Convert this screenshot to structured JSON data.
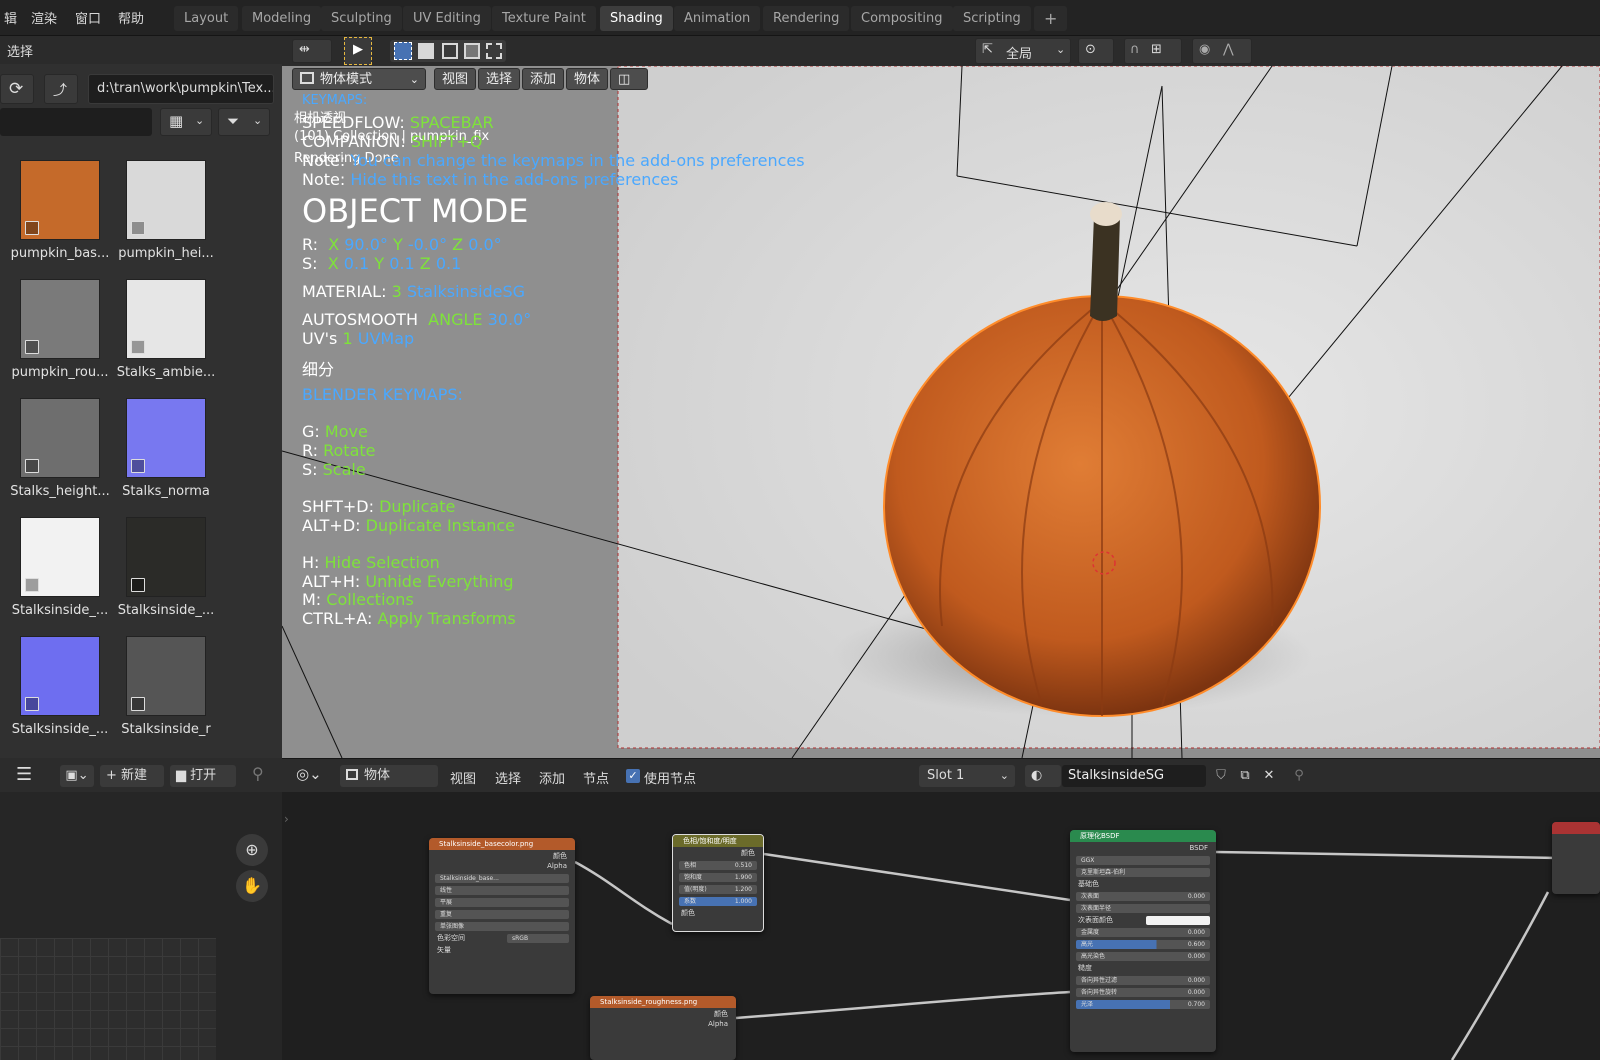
{
  "menu": [
    "辑",
    "渲染",
    "窗口",
    "帮助"
  ],
  "workspaces": [
    {
      "label": "Layout",
      "active": false
    },
    {
      "label": "Modeling",
      "active": false
    },
    {
      "label": "Sculpting",
      "active": false
    },
    {
      "label": "UV Editing",
      "active": false
    },
    {
      "label": "Texture Paint",
      "active": false
    },
    {
      "label": "Shading",
      "active": true
    },
    {
      "label": "Animation",
      "active": false
    },
    {
      "label": "Rendering",
      "active": false
    },
    {
      "label": "Compositing",
      "active": false
    },
    {
      "label": "Scripting",
      "active": false
    }
  ],
  "add_tab": "+",
  "filebrowser": {
    "select_label": "选择",
    "path": "d:\\tran\\work\\pumpkin\\Tex...",
    "files": [
      {
        "label": "pumpkin_bas...",
        "color": "#c56a2a"
      },
      {
        "label": "pumpkin_hei...",
        "color": "#d9d9d9"
      },
      {
        "label": "pumpkin_rou...",
        "color": "#7a7a7a"
      },
      {
        "label": "Stalks_ambie...",
        "color": "#e6e6e6"
      },
      {
        "label": "Stalks_height...",
        "color": "#6e6e6e"
      },
      {
        "label": "Stalks_norma",
        "color": "#7878f0"
      },
      {
        "label": "Stalksinside_...",
        "color": "#f2f2f2"
      },
      {
        "label": "Stalksinside_...",
        "color": "#2b2b28"
      },
      {
        "label": "Stalksinside_...",
        "color": "#6e6ef0"
      },
      {
        "label": "Stalksinside_r",
        "color": "#555555"
      }
    ]
  },
  "viewport": {
    "transform_orientation": "全局",
    "mode": "物体模式",
    "menus": [
      "视图",
      "选择",
      "添加",
      "物体"
    ],
    "overlay": {
      "camera": "相机透视",
      "collection": "(101) Collection | pumpkin_fix",
      "rendering": "Rendering Done",
      "keymaps_header": "KEYMAPS:",
      "speedflow_key": "SPEEDFLOW:",
      "speedflow_val": "SPACEBAR",
      "companion_key": "COMPANION:",
      "companion_val": "SHIFT+Q",
      "note1_key": "Note:",
      "note1_val": "You can change the keymaps in the add-ons preferences",
      "note2_key": "Note:",
      "note2_val": "Hide this text in the add-ons preferences",
      "mode_title": "OBJECT MODE",
      "rot_label": "R:",
      "rot_x": "X",
      "rot_x_val": "90.0°",
      "rot_y": "Y",
      "rot_y_val": "-0.0°",
      "rot_z": "Z",
      "rot_z_val": "0.0°",
      "scale_label": "S:",
      "scale_x": "X",
      "scale_x_val": "0.1",
      "scale_y": "Y",
      "scale_y_val": "0.1",
      "scale_z": "Z",
      "scale_z_val": "0.1",
      "material_label": "MATERIAL:",
      "material_count": "3",
      "material_name": "StalksinsideSG",
      "autosmooth_label": "AUTOSMOOTH",
      "angle_label": "ANGLE",
      "angle_val": "30.0°",
      "uvs_label": "UV's",
      "uvs_count": "1",
      "uv_name": "UVMap",
      "subdiv": "细分",
      "blender_keymaps": "BLENDER KEYMAPS:",
      "keys": [
        {
          "key": "G:",
          "action": "Move"
        },
        {
          "key": "R:",
          "action": "Rotate"
        },
        {
          "key": "S:",
          "action": "Scale"
        },
        {
          "key": "SHFT+D:",
          "action": "Duplicate"
        },
        {
          "key": "ALT+D:",
          "action": "Duplicate Instance"
        },
        {
          "key": "H:",
          "action": "Hide Selection"
        },
        {
          "key": "ALT+H:",
          "action": "Unhide Everything"
        },
        {
          "key": "M:",
          "action": "Collections"
        },
        {
          "key": "CTRL+A:",
          "action": "Apply Transforms"
        }
      ]
    }
  },
  "node_editor": {
    "object_type": "物体",
    "menus": [
      "视图",
      "选择",
      "添加",
      "节点"
    ],
    "use_nodes_label": "使用节点",
    "slot": "Slot 1",
    "material": "StalksinsideSG",
    "nodes": {
      "tex1_title": "Stalksinside_basecolor.png",
      "tex1_out_color": "颜色",
      "tex1_out_alpha": "Alpha",
      "tex1_image": "Stalksinside_base...",
      "tex1_opts": [
        "线性",
        "平展",
        "重复",
        "单张图像"
      ],
      "tex1_colorspace_label": "色彩空间",
      "tex1_colorspace": "sRGB",
      "tex1_vector": "矢量",
      "hsv_title": "色相/饱和度/明度",
      "hsv_out": "颜色",
      "hsv_fields": [
        {
          "label": "色相",
          "value": "0.510"
        },
        {
          "label": "饱和度",
          "value": "1.900"
        },
        {
          "label": "值(明度)",
          "value": "1.200"
        },
        {
          "label": "系数",
          "value": "1.000"
        }
      ],
      "hsv_in": "颜色",
      "bsdf_title": "原理化BSDF",
      "bsdf_out": "BSDF",
      "bsdf_dist": "GGX",
      "bsdf_sss": "克里斯坦森-伯利",
      "bsdf_rows": [
        {
          "label": "基础色",
          "value": ""
        },
        {
          "label": "次表面",
          "value": "0.000"
        },
        {
          "label": "次表面半径",
          "value": ""
        },
        {
          "label": "次表面颜色",
          "value": ""
        },
        {
          "label": "金属度",
          "value": "0.000"
        },
        {
          "label": "高光",
          "value": "0.600"
        },
        {
          "label": "高光染色",
          "value": "0.000"
        },
        {
          "label": "糙度",
          "value": ""
        },
        {
          "label": "各向异性过滤",
          "value": "0.000"
        },
        {
          "label": "各向异性旋转",
          "value": "0.000"
        },
        {
          "label": "光泽",
          "value": "0.700"
        }
      ],
      "tex2_title": "Stalksinside_roughness.png",
      "tex2_out_color": "颜色",
      "tex2_out_alpha": "Alpha"
    }
  },
  "image_editor": {
    "new_label": "新建",
    "open_label": "打开"
  }
}
